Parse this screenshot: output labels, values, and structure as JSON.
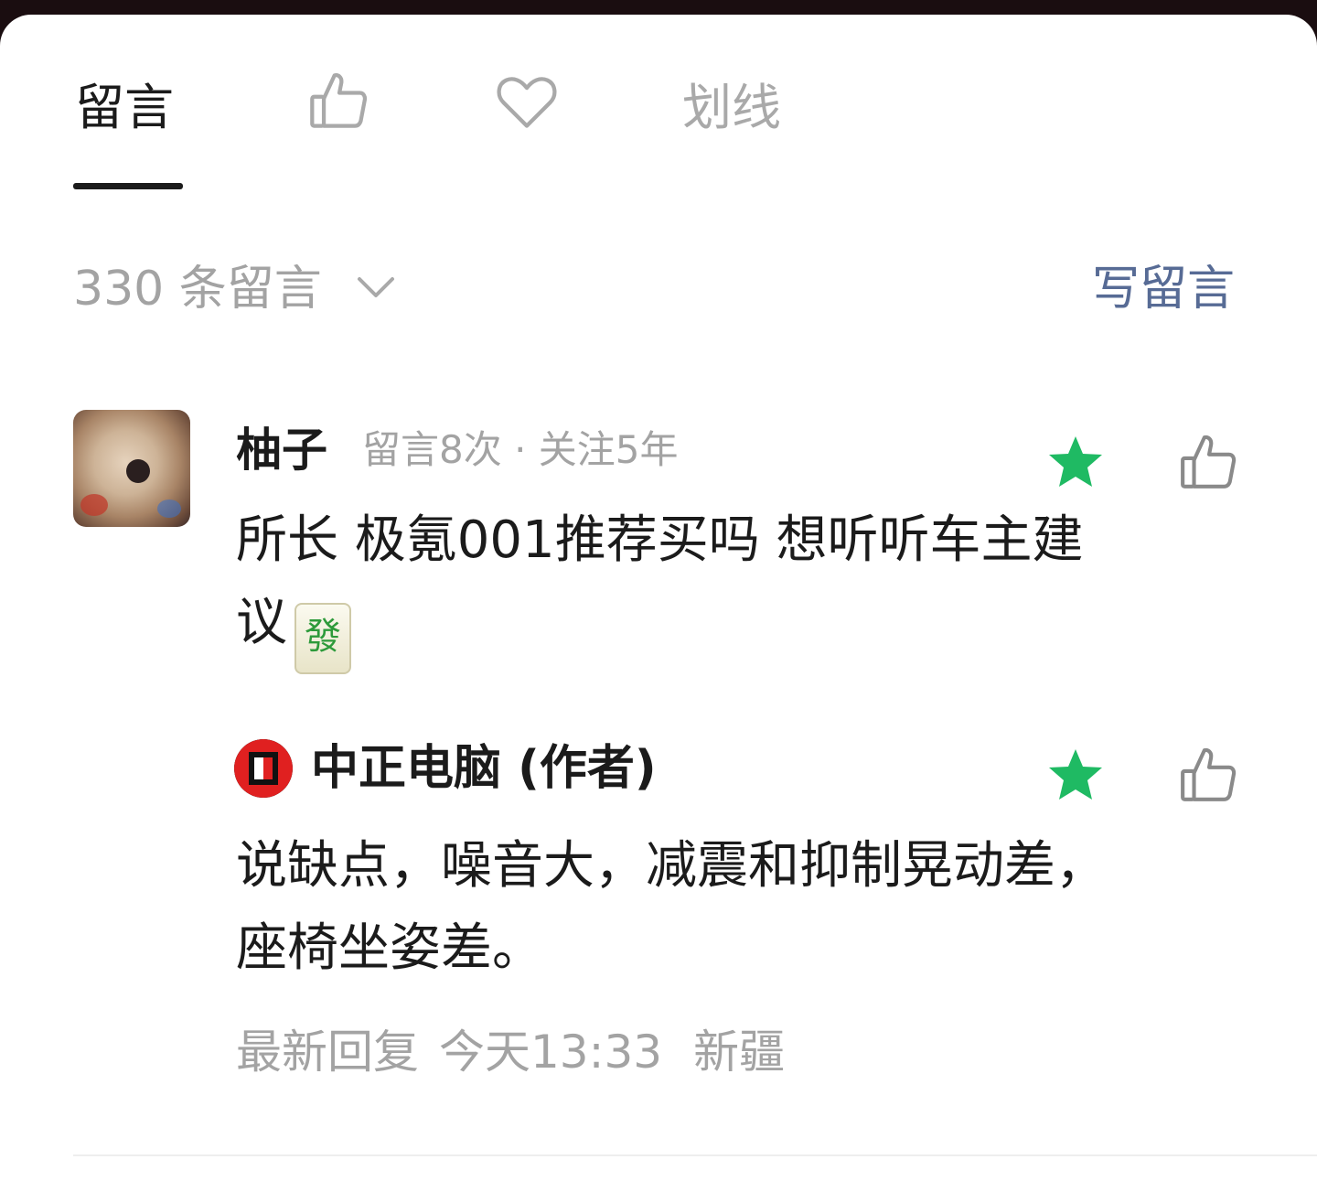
{
  "tabs": {
    "comments_label": "留言",
    "like_icon": "thumbs-up-icon",
    "favorite_icon": "heart-icon",
    "highlights_label": "划线"
  },
  "comments_header": {
    "count_label": "330 条留言",
    "sort_icon": "chevron-down-icon",
    "write_label": "写留言"
  },
  "comment": {
    "username": "柚子",
    "meta": "留言8次 · 关注5年",
    "text_line1": "所长 极氪001推荐买吗 想听听车主建",
    "text_line2": "议",
    "emoji": "發",
    "star_icon": "star-icon",
    "like_icon": "thumbs-up-icon"
  },
  "reply": {
    "author": "中正电脑 (作者)",
    "text_line1": "说缺点，噪音大，减震和抑制晃动差，",
    "text_line2": "座椅坐姿差。",
    "star_icon": "star-icon",
    "like_icon": "thumbs-up-icon"
  },
  "footer": {
    "latest_label": "最新回复",
    "time": "今天13:33",
    "location": "新疆"
  },
  "colors": {
    "accent_link": "#576b95",
    "star_green": "#1fba63",
    "muted_text": "#a3a3a3",
    "primary_text": "#1b1b1b"
  }
}
